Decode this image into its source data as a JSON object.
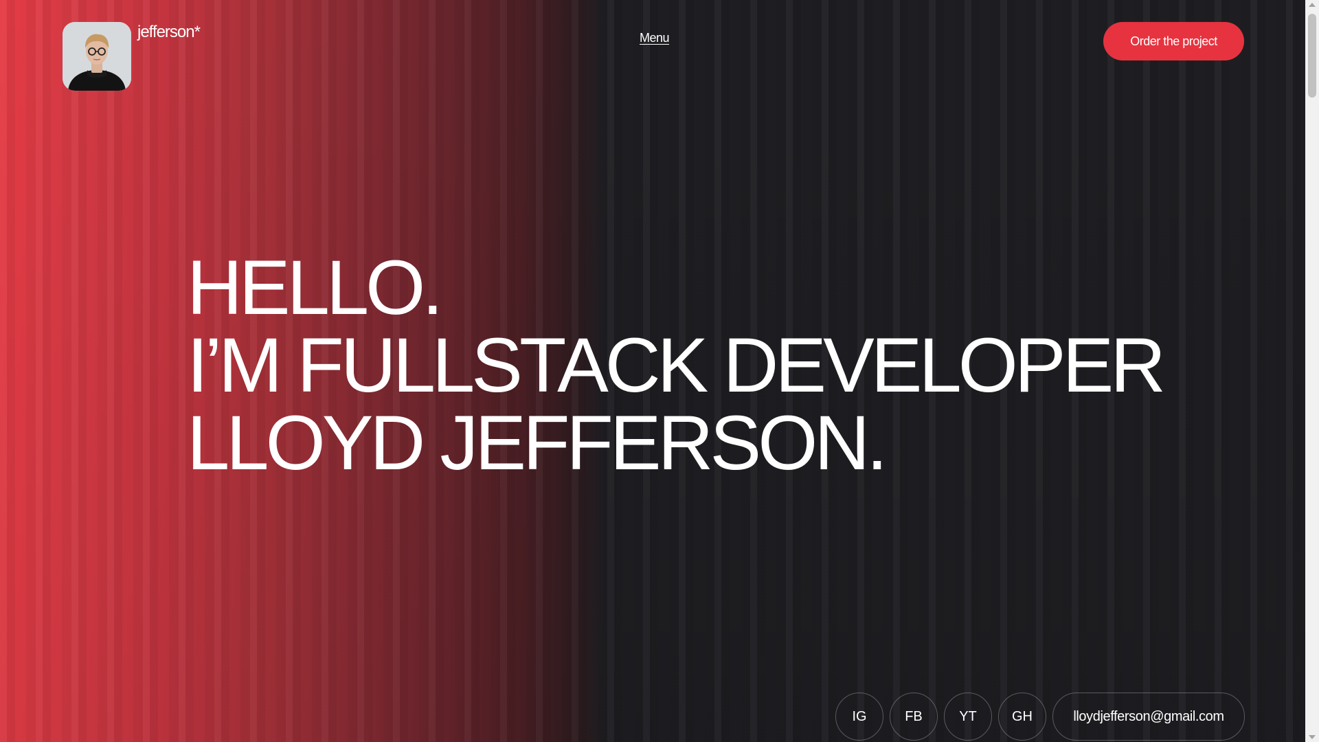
{
  "header": {
    "brand": "jefferson*",
    "menu_label": "Menu",
    "order_button_label": "Order the project"
  },
  "hero": {
    "lines": [
      "HELLO.",
      "I’M FULLSTACK DEVELOPER",
      "LLOYD JEFFERSON."
    ]
  },
  "social": {
    "ig": "IG",
    "fb": "FB",
    "yt": "YT",
    "gh": "GH",
    "email": "lloydjefferson@gmail.com"
  },
  "colors": {
    "accent": "#e7333f",
    "background_dark": "#1e1e22",
    "gradient_red": "#e53b45",
    "text": "#ffffff"
  },
  "icons": {
    "avatar": "profile-photo"
  }
}
